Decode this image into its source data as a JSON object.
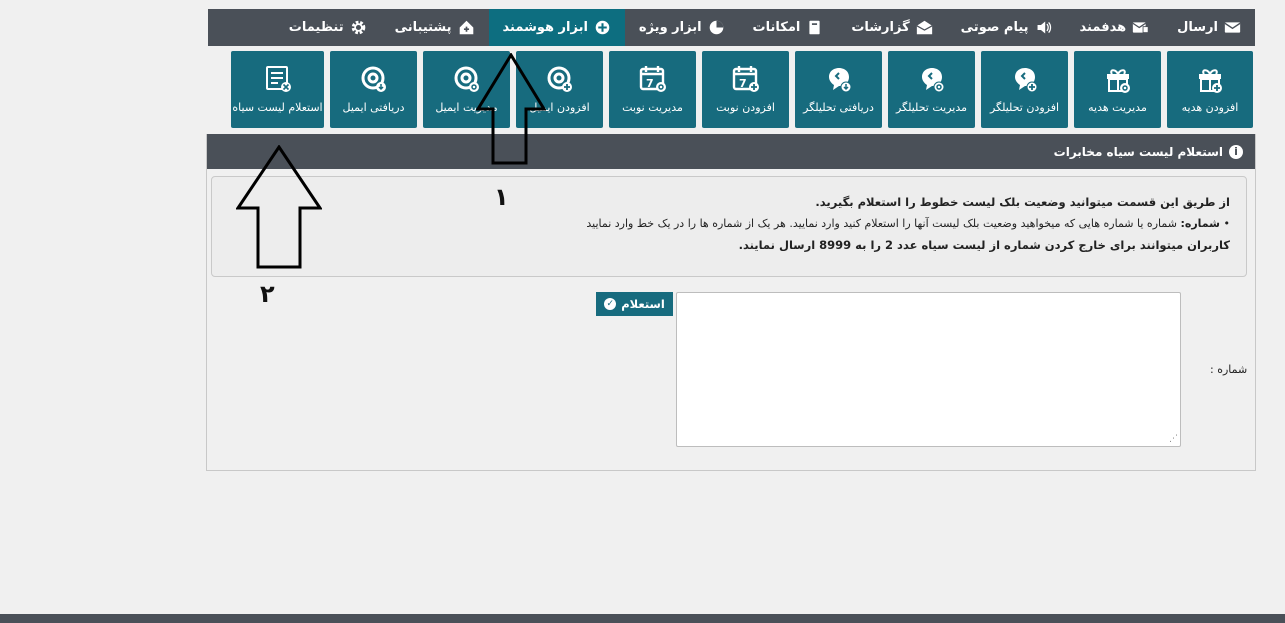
{
  "topnav": {
    "items": [
      {
        "label": "ارسال",
        "icon": "envelope-icon"
      },
      {
        "label": "هدفمند",
        "icon": "envelope-list-icon"
      },
      {
        "label": "پیام صوتی",
        "icon": "speaker-icon"
      },
      {
        "label": "گزارشات",
        "icon": "open-envelope-icon"
      },
      {
        "label": "امکانات",
        "icon": "book-icon"
      },
      {
        "label": "ابزار ویژه",
        "icon": "pie-chart-icon"
      },
      {
        "label": "ابزار هوشمند",
        "icon": "plus-circle-icon"
      },
      {
        "label": "پشتیبانی",
        "icon": "home-icon"
      },
      {
        "label": "تنظیمات",
        "icon": "gear-icon"
      }
    ],
    "active": "ابزار هوشمند"
  },
  "tools": [
    {
      "label": "افزودن هدیه",
      "icon": "gift-add-icon"
    },
    {
      "label": "مدیریت هدیه",
      "icon": "gift-settings-icon"
    },
    {
      "label": "افزودن تحلیلگر",
      "icon": "chat-add-icon"
    },
    {
      "label": "مدیریت تحلیلگر",
      "icon": "chat-settings-icon"
    },
    {
      "label": "دریافتی تحلیلگر",
      "icon": "chat-download-icon"
    },
    {
      "label": "افزودن نوبت",
      "icon": "calendar-add-icon"
    },
    {
      "label": "مدیریت نوبت",
      "icon": "calendar-settings-icon"
    },
    {
      "label": "افزودن ایمیل",
      "icon": "email-add-icon"
    },
    {
      "label": "مدیریت ایمیل",
      "icon": "email-settings-icon"
    },
    {
      "label": "دریافتی ایمیل",
      "icon": "email-download-icon"
    },
    {
      "label": "استعلام لیست سیاه",
      "icon": "list-blocked-icon"
    }
  ],
  "panel": {
    "title": "استعلام لیست سیاه مخابرات",
    "notice": {
      "line1": "از طریق این قسمت میتوانید وضعیت بلک لیست خطوط را استعلام بگیرید.",
      "line2_key": "شماره:",
      "line2_text": " شماره یا شماره هایی که میخواهید وضعیت بلک لیست آنها را استعلام کنید وارد نمایید. هر یک از شماره ها را در یک خط وارد نمایید",
      "line3": "کاربران میتوانند برای خارج کردن شماره از لیست سیاه عدد 2 را به 8999 ارسال نمایند."
    },
    "query_button": "استعلام",
    "number_label": "شماره :",
    "number_value": ""
  },
  "annotations": {
    "marker1": "۱",
    "marker2": "۲"
  }
}
